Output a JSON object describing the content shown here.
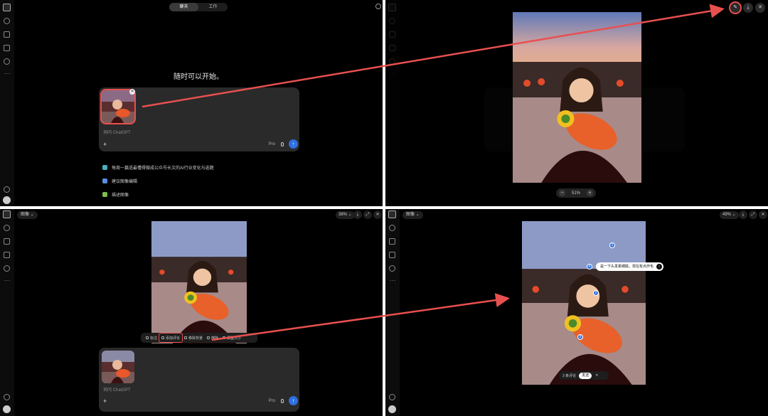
{
  "tabs": {
    "chat": "聊天",
    "work": "工作"
  },
  "heading": "随时可以开始。",
  "composer": {
    "placeholder": "询问 ChatGPT",
    "model": "Pro",
    "model_arrow": "⌄",
    "plus": "+",
    "send": "↑"
  },
  "suggestions": [
    {
      "label": "每周一篇适最懂得做成公众号长文的AI行业变化与选题",
      "color": "#4ab0c1"
    },
    {
      "label": "建议图像编辑",
      "color": "#5a8de0"
    },
    {
      "label": "描述图像",
      "color": "#7cbd4a"
    }
  ],
  "image_chip": "图像 ⌄",
  "zoom_tr": "51%",
  "zoom_minus": "−",
  "zoom_plus": "+",
  "zoom_bl": "38% ⌄",
  "zoom_br": "49% ⌄",
  "toolbar": {
    "select": "标注",
    "comment": "添加评论",
    "remove_bg": "移除背景",
    "erase": "擦除",
    "resize": "调整大小"
  },
  "comment_bubble": "是一下头发柔细腻，现在有点炸毛",
  "comment_bar": {
    "count": "3 条评论",
    "send": "发送",
    "close": "✕"
  },
  "pins": [
    "1",
    "2",
    "3",
    "4"
  ],
  "icons": {
    "pencil": "✎",
    "download": "⤓",
    "close": "✕",
    "expand": "⤢"
  }
}
